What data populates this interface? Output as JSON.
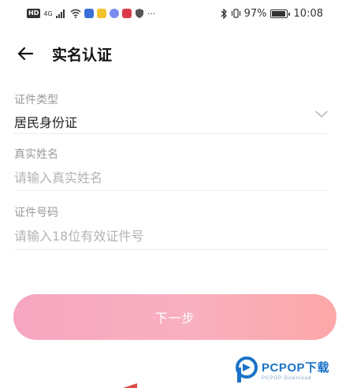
{
  "status_bar": {
    "hd": "HD",
    "network": "4G",
    "more": "···",
    "battery_percent": "97%",
    "battery_level": 0.97,
    "time": "10:08"
  },
  "header": {
    "title": "实名认证"
  },
  "form": {
    "id_type": {
      "label": "证件类型",
      "value": "居民身份证"
    },
    "real_name": {
      "label": "真实姓名",
      "placeholder": "请输入真实姓名"
    },
    "id_number": {
      "label": "证件号码",
      "placeholder": "请输入18位有效证件号"
    }
  },
  "actions": {
    "next_label": "下一步"
  },
  "watermark": {
    "brand": "PCPOP下载",
    "sub": "PCPOP Download"
  },
  "colors": {
    "button_start": "#f6a6c0",
    "button_end": "#fca7a8",
    "watermark": "#1a73c8"
  }
}
